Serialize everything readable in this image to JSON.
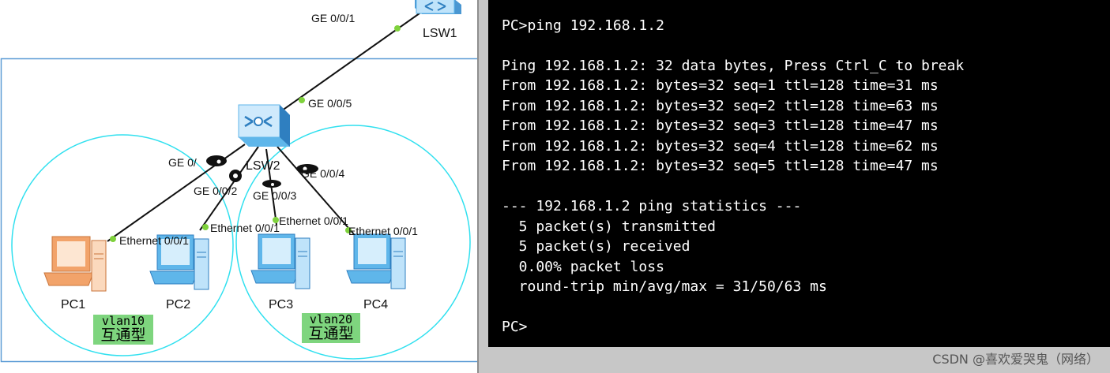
{
  "topology": {
    "devices": {
      "lsw1": "LSW1",
      "lsw2": "LSW2",
      "pc1": "PC1",
      "pc2": "PC2",
      "pc3": "PC3",
      "pc4": "PC4"
    },
    "ports": {
      "lsw1_uplink": "GE 0/0/1",
      "lsw2_uplink": "GE 0/0/5",
      "lsw2_p1": "GE 0/",
      "lsw2_p2": "GE 0/0/2",
      "lsw2_p3": "GE 0/0/3",
      "lsw2_p4": "GE 0/0/4",
      "pc1_eth": "Ethernet 0/0/1",
      "pc2_eth": "Ethernet 0/0/1",
      "pc3_eth": "Ethernet 0/0/1",
      "pc4_eth": "Ethernet 0/0/1"
    },
    "vlan_tags": [
      {
        "vlan": "vlan10",
        "note": "互通型"
      },
      {
        "vlan": "vlan20",
        "note": "互通型"
      }
    ],
    "colors": {
      "vlan_circle": "#30e0ef",
      "frame": "#5b9bd5",
      "link": "#111111",
      "port_dot": "#7fd23c",
      "tag_bg": "#7ed57e",
      "pc1_icon": "#f2a36a",
      "pc_icon": "#5fb6ea",
      "switch_icon": "#5fb6ea"
    }
  },
  "terminal": {
    "lines": [
      "PC>ping 192.168.1.2",
      "",
      "Ping 192.168.1.2: 32 data bytes, Press Ctrl_C to break",
      "From 192.168.1.2: bytes=32 seq=1 ttl=128 time=31 ms",
      "From 192.168.1.2: bytes=32 seq=2 ttl=128 time=63 ms",
      "From 192.168.1.2: bytes=32 seq=3 ttl=128 time=47 ms",
      "From 192.168.1.2: bytes=32 seq=4 ttl=128 time=62 ms",
      "From 192.168.1.2: bytes=32 seq=5 ttl=128 time=47 ms",
      "",
      "--- 192.168.1.2 ping statistics ---",
      "  5 packet(s) transmitted",
      "  5 packet(s) received",
      "  0.00% packet loss",
      "  round-trip min/avg/max = 31/50/63 ms",
      "",
      "PC>"
    ],
    "colors": {
      "background": "#000000",
      "text": "#ffffff"
    }
  },
  "watermark": "CSDN @喜欢爱哭鬼（网络）"
}
